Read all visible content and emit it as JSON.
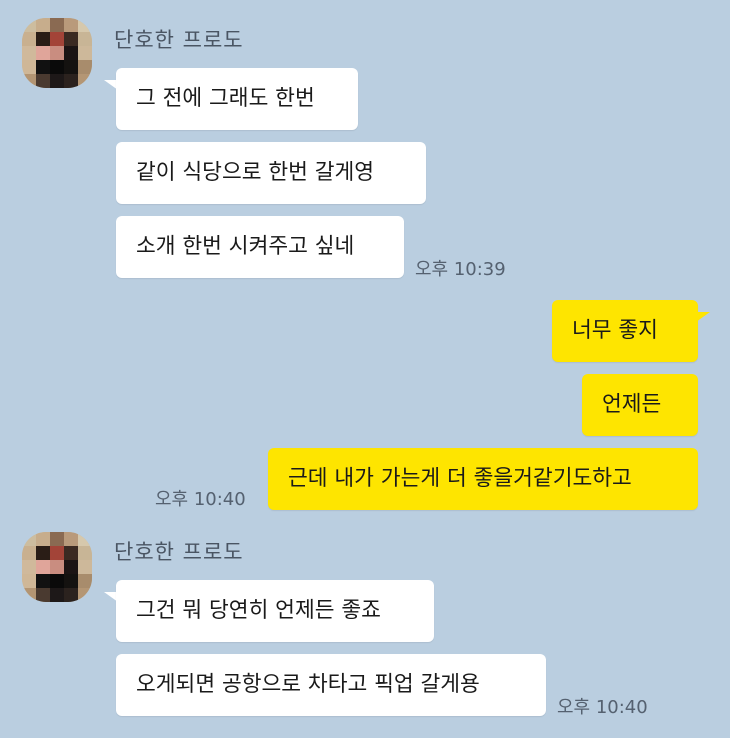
{
  "colors": {
    "background": "#bacee0",
    "incoming_bubble": "#ffffff",
    "outgoing_bubble": "#fee500",
    "sender_name": "#4a5563",
    "timestamp": "#556170"
  },
  "groups": [
    {
      "direction": "incoming",
      "sender": "단호한 프로도",
      "avatar_icon": "pixelated-profile-photo",
      "messages": [
        "그 전에 그래도 한번",
        "같이 식당으로 한번 갈게영",
        "소개 한번 시켜주고 싶네"
      ],
      "time": "오후 10:39"
    },
    {
      "direction": "outgoing",
      "messages": [
        "너무 좋지",
        "언제든",
        "근데 내가 가는게 더 좋을거같기도하고"
      ],
      "time": "오후 10:40"
    },
    {
      "direction": "incoming",
      "sender": "단호한 프로도",
      "avatar_icon": "pixelated-profile-photo",
      "messages": [
        "그건 뭐 당연히 언제든 좋죠",
        "오게되면 공항으로 차타고 픽업 갈게용"
      ],
      "time": "오후 10:40"
    }
  ]
}
